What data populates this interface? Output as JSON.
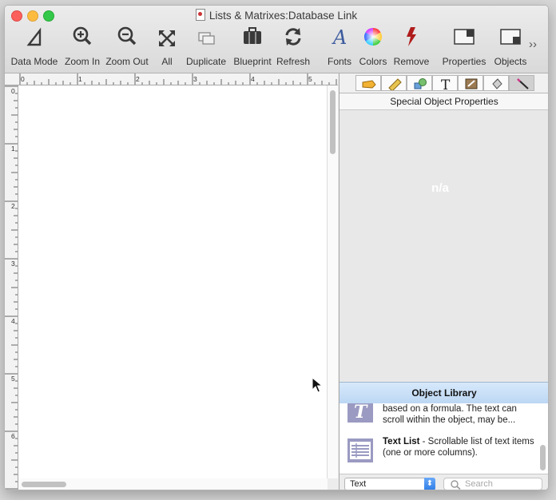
{
  "window": {
    "title": "Lists & Matrixes:Database Link"
  },
  "toolbar": {
    "items": [
      {
        "label": "Data Mode",
        "icon": "data-mode-icon"
      },
      {
        "label": "Zoom In",
        "icon": "zoom-in-icon"
      },
      {
        "label": "Zoom Out",
        "icon": "zoom-out-icon"
      },
      {
        "label": "All",
        "icon": "expand-all-icon"
      },
      {
        "label": "Duplicate",
        "icon": "duplicate-icon"
      },
      {
        "label": "Blueprint",
        "icon": "briefcase-icon"
      },
      {
        "label": "Refresh",
        "icon": "refresh-icon"
      },
      {
        "label": "Fonts",
        "icon": "font-a-icon"
      },
      {
        "label": "Colors",
        "icon": "color-wheel-icon"
      },
      {
        "label": "Remove",
        "icon": "lightning-icon"
      },
      {
        "label": "Properties",
        "icon": "properties-panel-icon"
      },
      {
        "label": "Objects",
        "icon": "objects-panel-icon"
      }
    ],
    "overflow": "››"
  },
  "ruler": {
    "top_labels": [
      "0",
      "1",
      "2",
      "3",
      "4",
      "5"
    ],
    "left_labels": [
      "0",
      "1",
      "2",
      "3",
      "4",
      "5",
      "6"
    ]
  },
  "panel": {
    "tabs": [
      "tag-icon",
      "ruler-icon",
      "shapes-icon",
      "text-t-icon",
      "image-edit-icon",
      "fill-bucket-icon",
      "wand-icon"
    ],
    "active_tab": 6,
    "properties_title": "Special Object Properties",
    "properties_value": "n/a",
    "library_title": "Object Library",
    "library_items": [
      {
        "name": "",
        "description": "based on a formula. The text can scroll within the object, may be..."
      },
      {
        "name": "Text List",
        "description": " - Scrollable list of text items (one or more columns)."
      }
    ],
    "filter": {
      "selected": "Text",
      "arrow": "⬍"
    },
    "search": {
      "placeholder": "Search"
    }
  },
  "colors": {
    "accent": "#2f7de8",
    "remove": "#b01c1c",
    "close": "#fc605c",
    "minimize": "#fdbc40",
    "maximize": "#34c84a"
  }
}
